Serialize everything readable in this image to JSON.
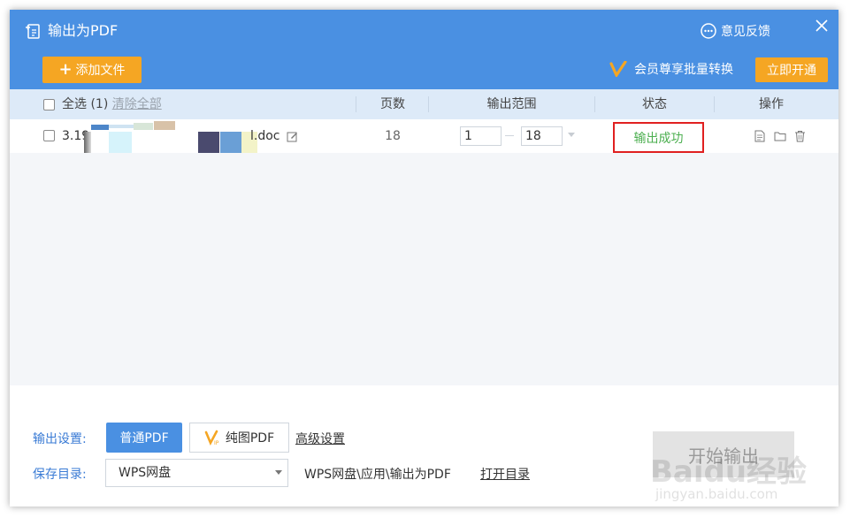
{
  "window": {
    "title": "输出为PDF",
    "feedback_label": "意见反馈"
  },
  "toolbar": {
    "add_file_label": "添加文件",
    "vip_text": "会员尊享批量转换",
    "open_vip_label": "立即开通"
  },
  "table": {
    "select_all_label": "全选 (1)",
    "clear_all_label": "清除全部",
    "columns": {
      "pages": "页数",
      "range": "输出范围",
      "status": "状态",
      "actions": "操作"
    },
    "rows": [
      {
        "file_name_start": "3.19",
        "file_name_end": "l.doc",
        "pages": "18",
        "range_from": "1",
        "range_to": "18",
        "status": "输出成功"
      }
    ]
  },
  "footer": {
    "output_settings_label": "输出设置:",
    "normal_pdf_label": "普通PDF",
    "image_pdf_label": "纯图PDF",
    "advanced_settings_label": "高级设置",
    "save_dir_label": "保存目录:",
    "save_dir_value": "WPS网盘",
    "save_path": "WPS网盘\\应用\\输出为PDF",
    "open_dir_label": "打开目录",
    "start_label": "开始输出"
  },
  "watermark": {
    "brand": "Baidu经验",
    "url": "jingyan.baidu.com"
  },
  "colors": {
    "header": "#4a90e2",
    "accent_orange": "#f5a623",
    "success_green": "#4caf50",
    "highlight_red": "#e02020"
  }
}
